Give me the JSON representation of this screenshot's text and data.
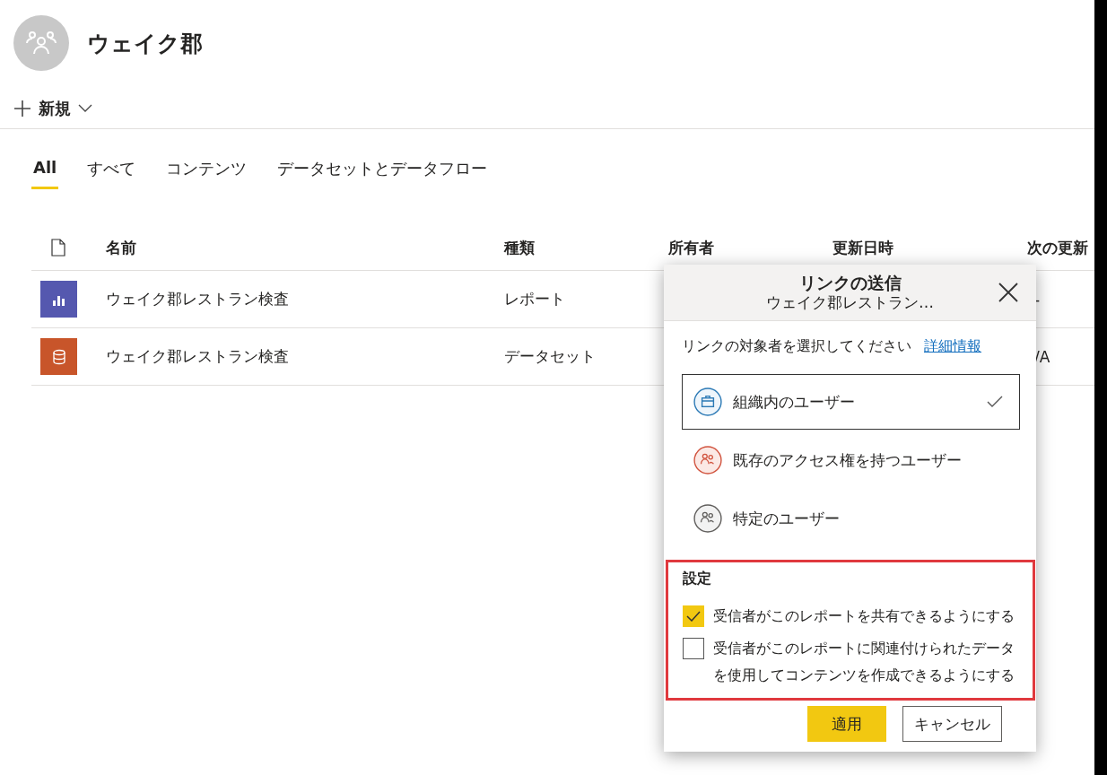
{
  "workspace": {
    "title": "ウェイク郡"
  },
  "toolbar": {
    "new_label": "新規"
  },
  "tabs": [
    {
      "label": "All",
      "selected": true
    },
    {
      "label": "すべて",
      "selected": false
    },
    {
      "label": "コンテンツ",
      "selected": false
    },
    {
      "label": "データセットとデータフロー",
      "selected": false
    }
  ],
  "table": {
    "columns": [
      "名前",
      "種類",
      "所有者",
      "更新日時",
      "次の更新"
    ],
    "rows": [
      {
        "kind": "report",
        "name": "ウェイク郡レストラン検査",
        "type": "レポート",
        "column_5": "-"
      },
      {
        "kind": "dataset",
        "name": "ウェイク郡レストラン検査",
        "type": "データセット",
        "column_5": "/A"
      }
    ]
  },
  "dialog": {
    "title": "リンクの送信",
    "subtitle": "ウェイク郡レストラン…",
    "prompt": "リンクの対象者を選択してください",
    "link": "詳細情報",
    "options": [
      {
        "kind": "organization",
        "label": "組織内のユーザー",
        "selected": true
      },
      {
        "kind": "existing",
        "label": "既存のアクセス権を持つユーザー",
        "selected": false
      },
      {
        "kind": "specific",
        "label": "特定のユーザー",
        "selected": false
      }
    ],
    "settings": {
      "heading": "設定",
      "checkboxes": [
        {
          "label": "受信者がこのレポートを共有できるようにする",
          "checked": true
        },
        {
          "label": "受信者がこのレポートに関連付けられたデータを使用してコンテンツを作成できるようにする",
          "checked": false
        }
      ]
    },
    "apply": "適用",
    "cancel": "キャンセル"
  }
}
